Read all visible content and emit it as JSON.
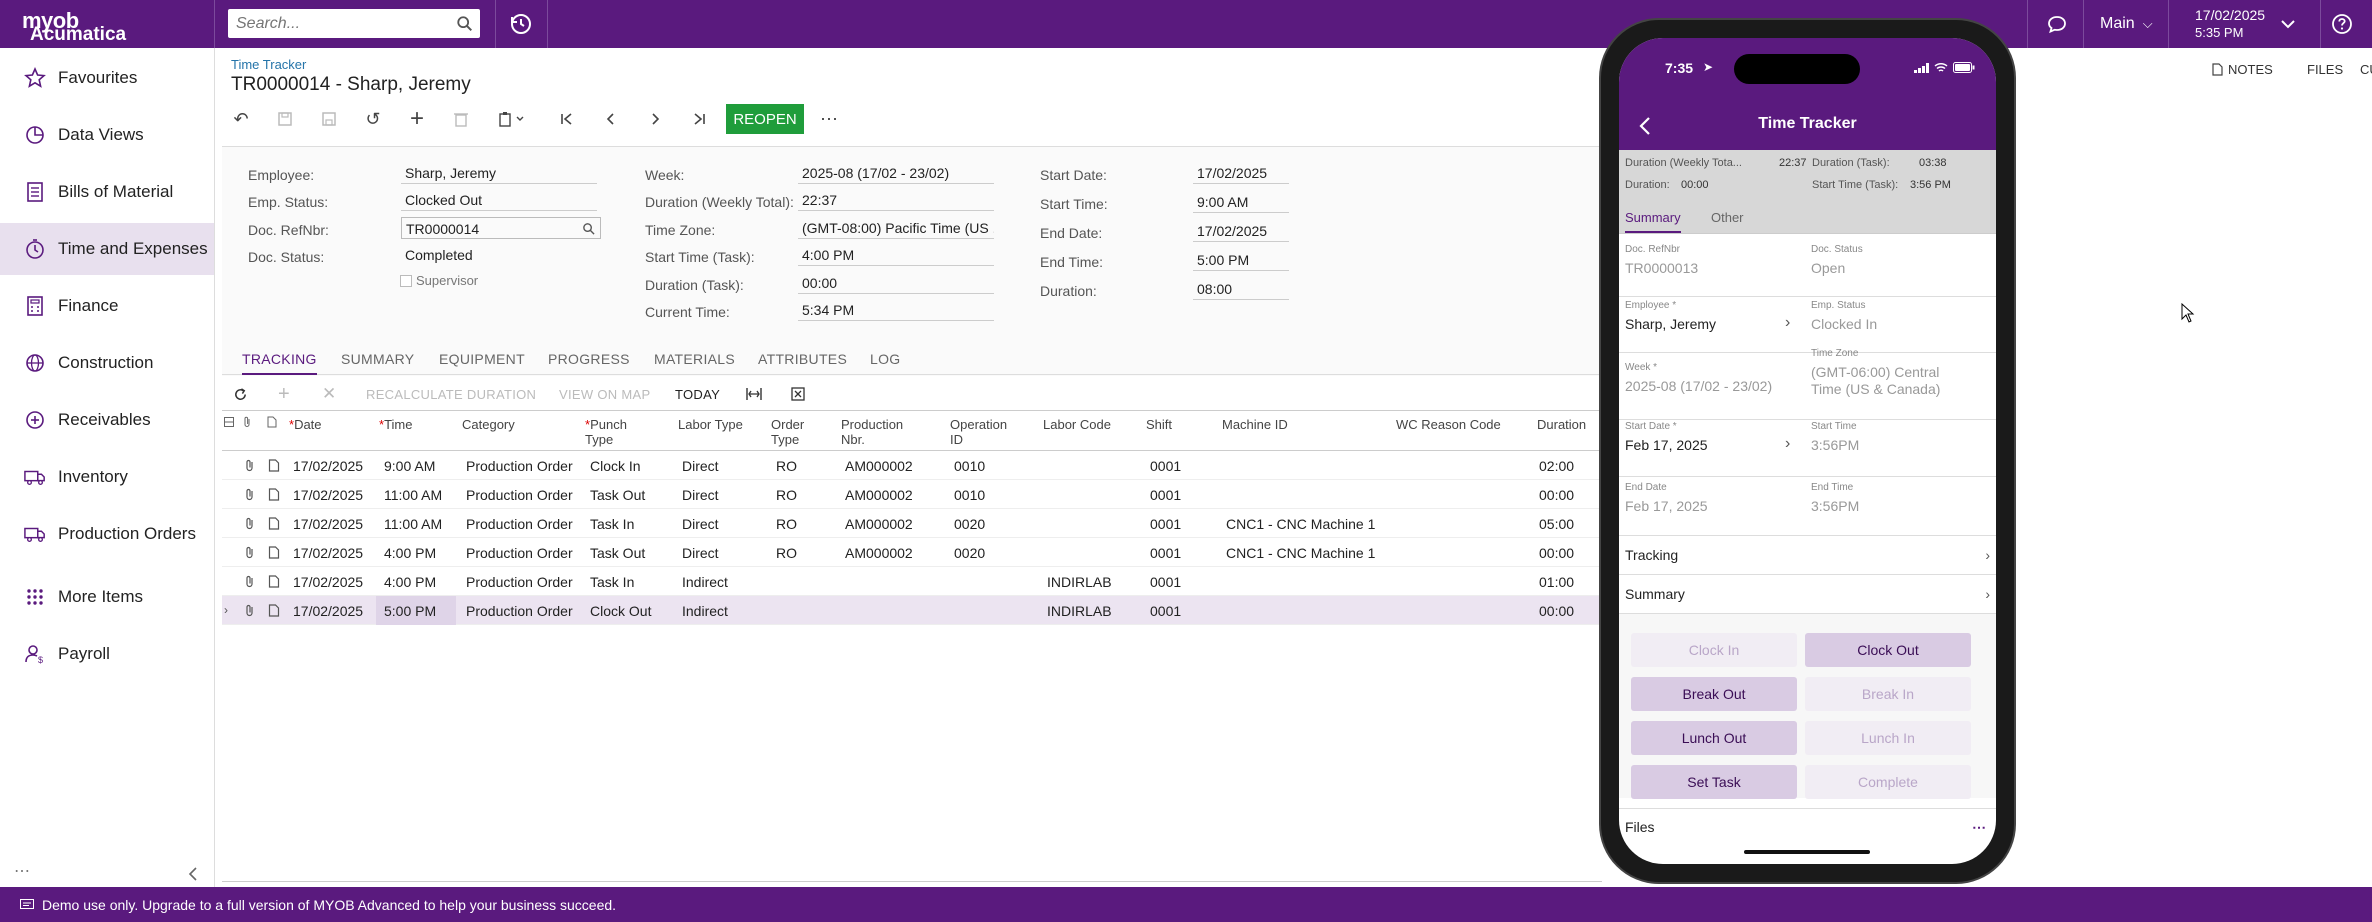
{
  "topbar": {
    "logo_line1": "myob",
    "logo_line2": "Acumatica",
    "search_placeholder": "Search...",
    "company": "Main",
    "date": "17/02/2025",
    "time": "5:35 PM",
    "bg_color": "#5a1a7e"
  },
  "sidebar": {
    "items": [
      {
        "label": "Favourites",
        "icon": "star-icon"
      },
      {
        "label": "Data Views",
        "icon": "pie-chart-icon"
      },
      {
        "label": "Bills of Material",
        "icon": "document-icon"
      },
      {
        "label": "Time and Expenses",
        "icon": "clock-icon"
      },
      {
        "label": "Finance",
        "icon": "calculator-icon"
      },
      {
        "label": "Construction",
        "icon": "globe-icon"
      },
      {
        "label": "Receivables",
        "icon": "plus-circle-icon"
      },
      {
        "label": "Inventory",
        "icon": "truck-icon"
      },
      {
        "label": "Production Orders",
        "icon": "factory-icon"
      },
      {
        "label": "More Items",
        "icon": "grid-icon"
      },
      {
        "label": "Payroll",
        "icon": "user-dollar-icon"
      }
    ],
    "collapse_icon": "chevron-left-icon"
  },
  "page": {
    "breadcrumb": "Time Tracker",
    "title": "TR0000014 - Sharp, Jeremy",
    "reopen_label": "REOPEN",
    "notes_label": "NOTES",
    "files_label": "FILES",
    "cu_label": "CU"
  },
  "form": {
    "employee_label": "Employee:",
    "employee": "Sharp, Jeremy",
    "emp_status_label": "Emp. Status:",
    "emp_status": "Clocked Out",
    "refnbr_label": "Doc. RefNbr:",
    "refnbr": "TR0000014",
    "doc_status_label": "Doc. Status:",
    "doc_status": "Completed",
    "supervisor_label": "Supervisor",
    "week_label": "Week:",
    "week": "2025-08 (17/02 - 23/02)",
    "dur_weekly_label": "Duration (Weekly Total):",
    "dur_weekly": "22:37",
    "timezone_label": "Time Zone:",
    "timezone": "(GMT-08:00) Pacific Time (US ...",
    "start_time_task_label": "Start Time (Task):",
    "start_time_task": "4:00 PM",
    "duration_task_label": "Duration (Task):",
    "duration_task": "00:00",
    "current_time_label": "Current Time:",
    "current_time": "5:34 PM",
    "start_date_label": "Start Date:",
    "start_date": "17/02/2025",
    "start_time_label": "Start Time:",
    "start_time": "9:00 AM",
    "end_date_label": "End Date:",
    "end_date": "17/02/2025",
    "end_time_label": "End Time:",
    "end_time": "5:00 PM",
    "duration_label": "Duration:",
    "duration": "08:00"
  },
  "tabs": [
    "TRACKING",
    "SUMMARY",
    "EQUIPMENT",
    "PROGRESS",
    "MATERIALS",
    "ATTRIBUTES",
    "LOG"
  ],
  "grid_toolbar": {
    "recalc": "RECALCULATE DURATION",
    "view_map": "VIEW ON MAP",
    "today": "TODAY"
  },
  "grid": {
    "headers": {
      "date": "Date",
      "time": "Time",
      "category": "Category",
      "punch1": "Punch",
      "punch2": "Type",
      "labor": "Labor Type",
      "order1": "Order",
      "order2": "Type",
      "prod1": "Production",
      "prod2": "Nbr.",
      "op1": "Operation",
      "op2": "ID",
      "laborcode": "Labor Code",
      "shift": "Shift",
      "machine": "Machine ID",
      "wc": "WC Reason Code",
      "duration": "Duration"
    },
    "rows": [
      {
        "date": "17/02/2025",
        "time": "9:00 AM",
        "category": "Production Order",
        "punch": "Clock In",
        "labor": "Direct",
        "order": "RO",
        "prod": "AM000002",
        "op": "0010",
        "laborcode": "",
        "shift": "0001",
        "machine": "",
        "duration": "02:00"
      },
      {
        "date": "17/02/2025",
        "time": "11:00 AM",
        "category": "Production Order",
        "punch": "Task Out",
        "labor": "Direct",
        "order": "RO",
        "prod": "AM000002",
        "op": "0010",
        "laborcode": "",
        "shift": "0001",
        "machine": "",
        "duration": "00:00"
      },
      {
        "date": "17/02/2025",
        "time": "11:00 AM",
        "category": "Production Order",
        "punch": "Task In",
        "labor": "Direct",
        "order": "RO",
        "prod": "AM000002",
        "op": "0020",
        "laborcode": "",
        "shift": "0001",
        "machine": "CNC1 - CNC Machine 1",
        "duration": "05:00"
      },
      {
        "date": "17/02/2025",
        "time": "4:00 PM",
        "category": "Production Order",
        "punch": "Task Out",
        "labor": "Direct",
        "order": "RO",
        "prod": "AM000002",
        "op": "0020",
        "laborcode": "",
        "shift": "0001",
        "machine": "CNC1 - CNC Machine 1",
        "duration": "00:00"
      },
      {
        "date": "17/02/2025",
        "time": "4:00 PM",
        "category": "Production Order",
        "punch": "Task In",
        "labor": "Indirect",
        "order": "",
        "prod": "",
        "op": "",
        "laborcode": "INDIRLAB",
        "shift": "0001",
        "machine": "",
        "duration": "01:00"
      },
      {
        "date": "17/02/2025",
        "time": "5:00 PM",
        "category": "Production Order",
        "punch": "Clock Out",
        "labor": "Indirect",
        "order": "",
        "prod": "",
        "op": "",
        "laborcode": "INDIRLAB",
        "shift": "0001",
        "machine": "",
        "duration": "00:00"
      }
    ]
  },
  "banner": "Demo use only. Upgrade to a full version of MYOB Advanced to help your business succeed.",
  "phone": {
    "clock": "7:35",
    "title": "Time Tracker",
    "sum_l1": "Duration (Weekly Tota...",
    "sum_v1": "22:37",
    "sum_l2": "Duration (Task):",
    "sum_v2": "03:38",
    "sum_l3": "Duration:",
    "sum_v3": "00:00",
    "sum_l4": "Start Time (Task):",
    "sum_v4": "3:56 PM",
    "tab_summary": "Summary",
    "tab_other": "Other",
    "refnbr_label": "Doc. RefNbr",
    "refnbr": "TR0000013",
    "status_label": "Doc. Status",
    "status": "Open",
    "employee_label": "Employee *",
    "employee": "Sharp, Jeremy",
    "emp_status_label": "Emp. Status",
    "emp_status": "Clocked In",
    "week_label": "Week *",
    "week": "2025-08 (17/02 - 23/02)",
    "tz_label": "Time Zone",
    "tz": "(GMT-06:00) Central Time (US & Canada)",
    "start_date_label": "Start Date *",
    "start_date": "Feb 17, 2025",
    "start_time_label": "Start Time",
    "start_time": "3:56PM",
    "end_date_label": "End Date",
    "end_date": "Feb 17, 2025",
    "end_time_label": "End Time",
    "end_time": "3:56PM",
    "tracking": "Tracking",
    "summary": "Summary",
    "btn_clock_in": "Clock In",
    "btn_clock_out": "Clock Out",
    "btn_break_out": "Break Out",
    "btn_break_in": "Break In",
    "btn_lunch_out": "Lunch Out",
    "btn_lunch_in": "Lunch In",
    "btn_set_task": "Set Task",
    "btn_complete": "Complete",
    "files": "Files"
  }
}
